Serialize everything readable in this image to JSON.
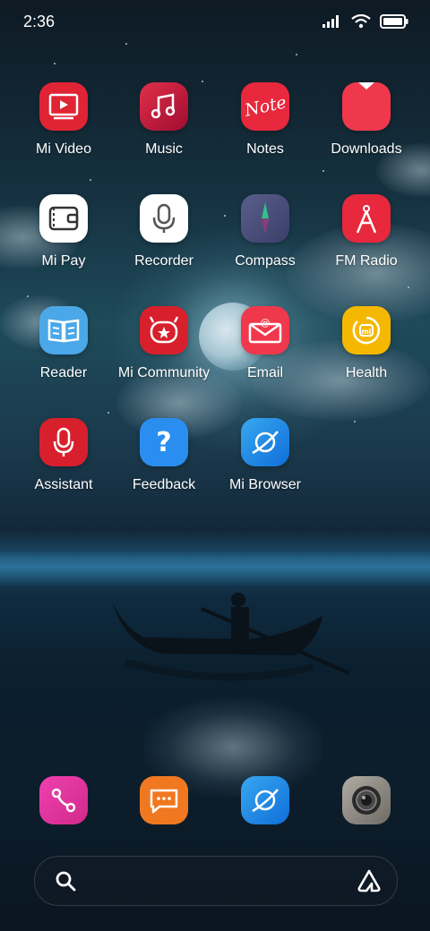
{
  "status_bar": {
    "time": "2:36",
    "icons": [
      "signal-icon",
      "wifi-icon",
      "battery-icon"
    ]
  },
  "apps": [
    {
      "label": "Mi Video",
      "icon": "mi-video-icon",
      "color": "#e02433"
    },
    {
      "label": "Music",
      "icon": "music-icon",
      "color": "#c8143c"
    },
    {
      "label": "Notes",
      "icon": "notes-icon",
      "color": "#e8283c"
    },
    {
      "label": "Downloads",
      "icon": "downloads-icon",
      "color": "#f0384c"
    },
    {
      "label": "Mi Pay",
      "icon": "mi-pay-icon",
      "color": "#ffffff"
    },
    {
      "label": "Recorder",
      "icon": "recorder-icon",
      "color": "#ffffff"
    },
    {
      "label": "Compass",
      "icon": "compass-icon",
      "color": "#4a4f7a"
    },
    {
      "label": "FM Radio",
      "icon": "fm-radio-icon",
      "color": "#e8283c"
    },
    {
      "label": "Reader",
      "icon": "reader-icon",
      "color": "#4aa8e8"
    },
    {
      "label": "Mi Community",
      "icon": "mi-community-icon",
      "color": "#d8202c"
    },
    {
      "label": "Email",
      "icon": "email-icon",
      "color": "#f0384c"
    },
    {
      "label": "Health",
      "icon": "health-icon",
      "color": "#f5b800"
    },
    {
      "label": "Assistant",
      "icon": "assistant-icon",
      "color": "#d8202c"
    },
    {
      "label": "Feedback",
      "icon": "feedback-icon",
      "color": "#2a8ef0"
    },
    {
      "label": "Mi Browser",
      "icon": "mi-browser-icon",
      "color": "#1a8ae8"
    }
  ],
  "dock": [
    {
      "icon": "phone-icon",
      "color": "#e83ca0"
    },
    {
      "icon": "messages-icon",
      "color": "#f07820"
    },
    {
      "icon": "browser-icon",
      "color": "#1a8ae8"
    },
    {
      "icon": "camera-icon",
      "color": "#8a8680"
    }
  ],
  "search": {
    "left_icon": "search-icon",
    "right_icon": "assistant-launch-icon"
  }
}
